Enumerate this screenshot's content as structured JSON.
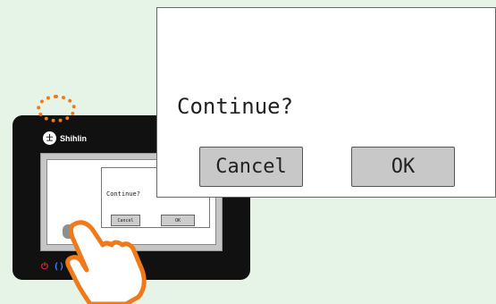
{
  "device": {
    "brand": "Shihlin",
    "brand_logo_text": "士"
  },
  "dialog": {
    "question": "Continue?",
    "cancel_label": "Cancel",
    "ok_label": "OK"
  },
  "status_icons": {
    "power": "⏻",
    "bracket": "()"
  },
  "colors": {
    "background": "#e5f4e7",
    "highlight": "#f07a1a",
    "button": "#c8c8c8"
  }
}
